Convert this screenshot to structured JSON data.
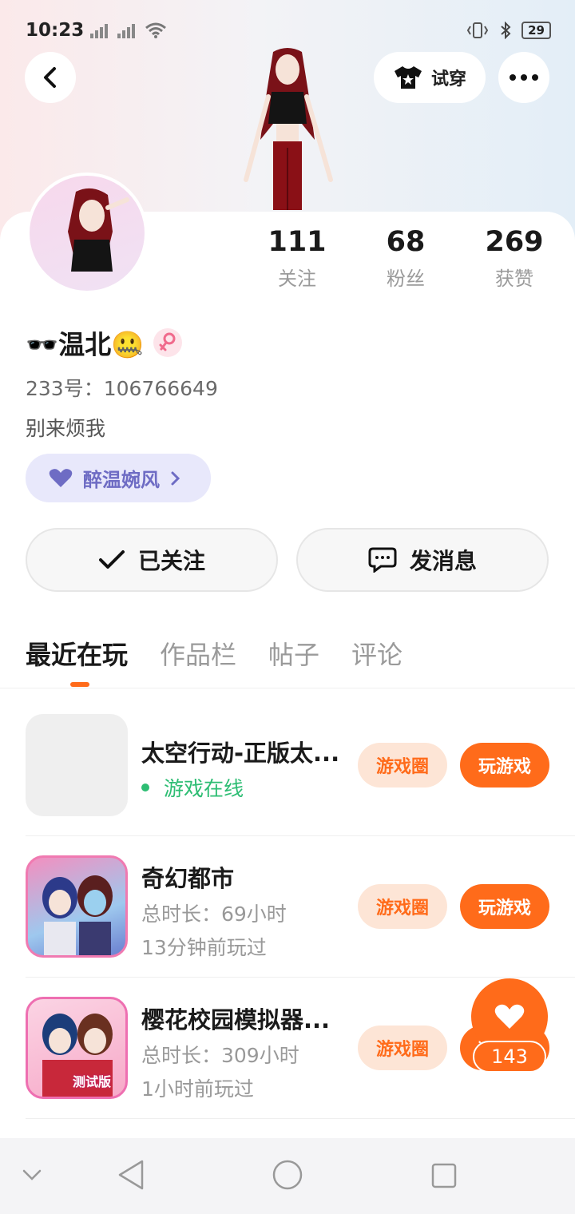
{
  "status_bar": {
    "time": "10:23",
    "battery": "29"
  },
  "header": {
    "try_on_label": "试穿"
  },
  "profile": {
    "stats": [
      {
        "value": "111",
        "label": "关注"
      },
      {
        "value": "68",
        "label": "粉丝"
      },
      {
        "value": "269",
        "label": "获赞"
      }
    ],
    "username": "🕶️温北🤐",
    "user_id": "233号：106766649",
    "bio": "别来烦我",
    "tag_label": "醉温婉风"
  },
  "actions": {
    "following_label": "已关注",
    "message_label": "发消息"
  },
  "tabs": [
    "最近在玩",
    "作品栏",
    "帖子",
    "评论"
  ],
  "games": [
    {
      "title": "太空行动-正版太...",
      "status": "游戏在线",
      "circle": "游戏圈",
      "play": "玩游戏"
    },
    {
      "title": "奇幻都市",
      "duration": "总时长：69小时",
      "last_played": "13分钟前玩过",
      "circle": "游戏圈",
      "play": "玩游戏"
    },
    {
      "title": "樱花校园模拟器...",
      "duration": "总时长：309小时",
      "last_played": "1小时前玩过",
      "circle": "游戏圈",
      "play": "玩游戏",
      "badge": "测试版"
    }
  ],
  "like_fab": {
    "count": "143"
  },
  "colors": {
    "accent": "#ff6b1a",
    "online": "#2dbd73",
    "tag_bg": "#e8e8fb"
  }
}
